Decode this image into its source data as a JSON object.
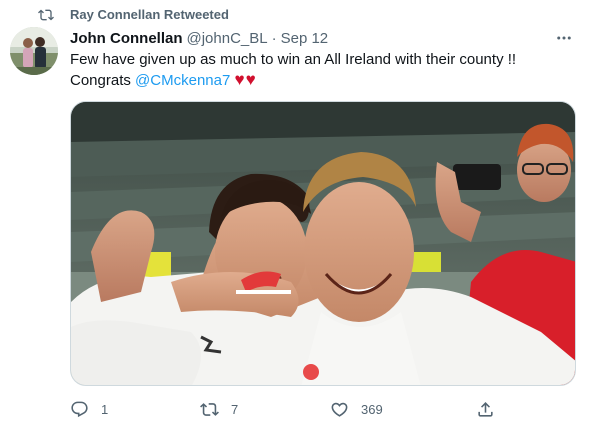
{
  "retweet": {
    "label": "Ray Connellan Retweeted",
    "icon": "retweet-icon"
  },
  "tweet": {
    "author_name": "John Connellan",
    "author_handle": "@johnC_BL",
    "separator": "·",
    "date": "Sep 12",
    "text_line1": "Few have given up as much to win an All Ireland with their county !!",
    "text_prefix": "Congrats ",
    "mention": "@CMckenna7",
    "hearts": "♥♥",
    "more_icon": "more-horizontal-icon"
  },
  "media": {
    "description_icon": "photo",
    "alt": ""
  },
  "actions": {
    "reply_count": "1",
    "retweet_count": "7",
    "like_count": "369",
    "share_icon": "share-icon"
  },
  "colors": {
    "text": "#0f1419",
    "secondary": "#536471",
    "link": "#1d9bf0",
    "heart": "#d1102e",
    "border": "#cfd9de"
  }
}
